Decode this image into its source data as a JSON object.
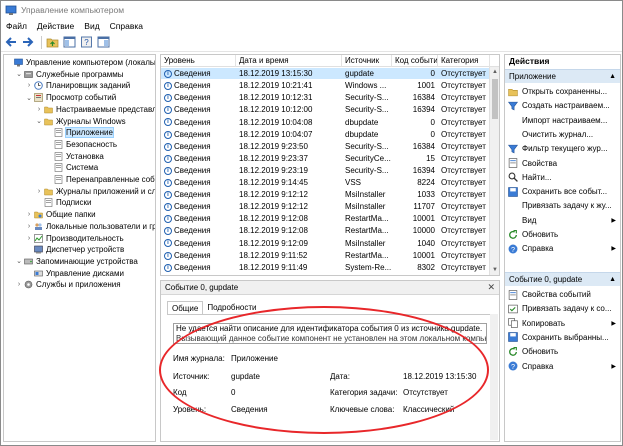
{
  "window": {
    "title": "Управление компьютером"
  },
  "menu": [
    "Файл",
    "Действие",
    "Вид",
    "Справка"
  ],
  "tree": [
    {
      "label": "Управление компьютером (локальны",
      "indent": 0,
      "exp": "",
      "icon": "computer"
    },
    {
      "label": "Служебные программы",
      "indent": 1,
      "exp": "v",
      "icon": "tools"
    },
    {
      "label": "Планировщик заданий",
      "indent": 2,
      "exp": ">",
      "icon": "clock"
    },
    {
      "label": "Просмотр событий",
      "indent": 2,
      "exp": "v",
      "icon": "event"
    },
    {
      "label": "Настраиваемые представле",
      "indent": 3,
      "exp": ">",
      "icon": "folder"
    },
    {
      "label": "Журналы Windows",
      "indent": 3,
      "exp": "v",
      "icon": "folder"
    },
    {
      "label": "Приложение",
      "indent": 4,
      "exp": "",
      "icon": "log",
      "selected": true
    },
    {
      "label": "Безопасность",
      "indent": 4,
      "exp": "",
      "icon": "log"
    },
    {
      "label": "Установка",
      "indent": 4,
      "exp": "",
      "icon": "log"
    },
    {
      "label": "Система",
      "indent": 4,
      "exp": "",
      "icon": "log"
    },
    {
      "label": "Перенаправленные событ",
      "indent": 4,
      "exp": "",
      "icon": "log"
    },
    {
      "label": "Журналы приложений и слу",
      "indent": 3,
      "exp": ">",
      "icon": "folder"
    },
    {
      "label": "Подписки",
      "indent": 3,
      "exp": "",
      "icon": "log"
    },
    {
      "label": "Общие папки",
      "indent": 2,
      "exp": ">",
      "icon": "share"
    },
    {
      "label": "Локальные пользователи и гру",
      "indent": 2,
      "exp": ">",
      "icon": "users"
    },
    {
      "label": "Производительность",
      "indent": 2,
      "exp": ">",
      "icon": "perf"
    },
    {
      "label": "Диспетчер устройств",
      "indent": 2,
      "exp": "",
      "icon": "device"
    },
    {
      "label": "Запоминающие устройства",
      "indent": 1,
      "exp": "v",
      "icon": "storage"
    },
    {
      "label": "Управление дисками",
      "indent": 2,
      "exp": "",
      "icon": "disk"
    },
    {
      "label": "Службы и приложения",
      "indent": 1,
      "exp": ">",
      "icon": "services"
    }
  ],
  "list": {
    "columns": [
      "Уровень",
      "Дата и время",
      "Источник",
      "Код событи",
      "Категория "
    ],
    "rows": [
      [
        "Сведения",
        "18.12.2019 13:15:30",
        "gupdate",
        "0",
        "Отсутствует"
      ],
      [
        "Сведения",
        "18.12.2019 10:21:41",
        "Windows ...",
        "1001",
        "Отсутствует"
      ],
      [
        "Сведения",
        "18.12.2019 10:12:31",
        "Security-S...",
        "16384",
        "Отсутствует"
      ],
      [
        "Сведения",
        "18.12.2019 10:12:00",
        "Security-S...",
        "16394",
        "Отсутствует"
      ],
      [
        "Сведения",
        "18.12.2019 10:04:08",
        "dbupdate",
        "0",
        "Отсутствует"
      ],
      [
        "Сведения",
        "18.12.2019 10:04:07",
        "dbupdate",
        "0",
        "Отсутствует"
      ],
      [
        "Сведения",
        "18.12.2019 9:23:50",
        "Security-S...",
        "16384",
        "Отсутствует"
      ],
      [
        "Сведения",
        "18.12.2019 9:23:37",
        "SecurityCe...",
        "15",
        "Отсутствует"
      ],
      [
        "Сведения",
        "18.12.2019 9:23:19",
        "Security-S...",
        "16394",
        "Отсутствует"
      ],
      [
        "Сведения",
        "18.12.2019 9:14:45",
        "VSS",
        "8224",
        "Отсутствует"
      ],
      [
        "Сведения",
        "18.12.2019 9:12:12",
        "MsiInstaller",
        "1033",
        "Отсутствует"
      ],
      [
        "Сведения",
        "18.12.2019 9:12:12",
        "MsiInstaller",
        "11707",
        "Отсутствует"
      ],
      [
        "Сведения",
        "18.12.2019 9:12:08",
        "RestartMa...",
        "10001",
        "Отсутствует"
      ],
      [
        "Сведения",
        "18.12.2019 9:12:08",
        "RestartMa...",
        "10000",
        "Отсутствует"
      ],
      [
        "Сведения",
        "18.12.2019 9:12:09",
        "MsiInstaller",
        "1040",
        "Отсутствует"
      ],
      [
        "Сведения",
        "18.12.2019 9:11:52",
        "RestartMa...",
        "10001",
        "Отсутствует"
      ],
      [
        "Сведения",
        "18.12.2019 9:11:49",
        "System-Re...",
        "8302",
        "Отсутствует"
      ]
    ]
  },
  "detail": {
    "title": "Событие 0, gupdate",
    "tabs": [
      "Общие",
      "Подробности"
    ],
    "description_line1": "Не удается найти описание для идентификатора события 0 из источника gupdate.",
    "description_line2": "Вызывающий данное событие компонент не установлен на этом локальном компьют",
    "labels": {
      "log_name": "Имя журнала:",
      "source": "Источник:",
      "code": "Код",
      "level": "Уровень:",
      "date": "Дата:",
      "category": "Категория задачи:",
      "keywords": "Ключевые слова:"
    },
    "values": {
      "log_name": "Приложение",
      "source": "gupdate",
      "code": "0",
      "level": "Сведения",
      "date": "18.12.2019 13:15:30",
      "category": "Отсутствует",
      "keywords": "Классический"
    }
  },
  "actions": {
    "title": "Действия",
    "section1": "Приложение",
    "section1_items": [
      {
        "label": "Открыть сохраненны...",
        "icon": "open-icon",
        "arrow": false
      },
      {
        "label": "Создать настраиваем...",
        "icon": "filter-icon",
        "arrow": false
      },
      {
        "label": "Импорт настраиваем...",
        "icon": "",
        "arrow": false
      },
      {
        "label": "Очистить журнал...",
        "icon": "",
        "arrow": false
      },
      {
        "label": "Фильтр текущего жур...",
        "icon": "filter-icon",
        "arrow": false
      },
      {
        "label": "Свойства",
        "icon": "properties-icon",
        "arrow": false
      },
      {
        "label": "Найти...",
        "icon": "find-icon",
        "arrow": false
      },
      {
        "label": "Сохранить все событ...",
        "icon": "save-icon",
        "arrow": false
      },
      {
        "label": "Привязать задачу к жу...",
        "icon": "",
        "arrow": false
      },
      {
        "label": "Вид",
        "icon": "",
        "arrow": true
      },
      {
        "label": "Обновить",
        "icon": "refresh-icon",
        "arrow": false
      },
      {
        "label": "Справка",
        "icon": "help-icon",
        "arrow": true
      }
    ],
    "section2": "Событие 0, gupdate",
    "section2_items": [
      {
        "label": "Свойства событий",
        "icon": "properties-icon",
        "arrow": false
      },
      {
        "label": "Привязать задачу к со...",
        "icon": "task-icon",
        "arrow": false
      },
      {
        "label": "Копировать",
        "icon": "copy-icon",
        "arrow": true
      },
      {
        "label": "Сохранить выбранны...",
        "icon": "save-icon",
        "arrow": false
      },
      {
        "label": "Обновить",
        "icon": "refresh-icon",
        "arrow": false
      },
      {
        "label": "Справка",
        "icon": "help-icon",
        "arrow": true
      }
    ]
  }
}
